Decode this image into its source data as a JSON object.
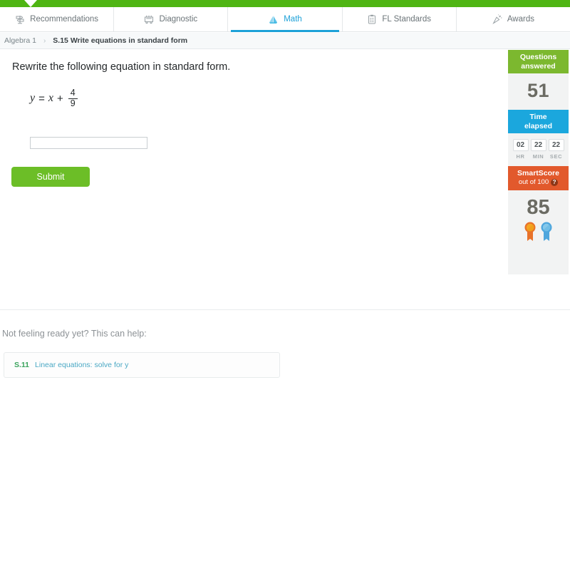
{
  "topbar": {
    "color": "#4fb513"
  },
  "tabs": [
    {
      "label": "Recommendations",
      "icon": "signpost-icon",
      "active": false
    },
    {
      "label": "Diagnostic",
      "icon": "diagnostic-machine-icon",
      "active": false
    },
    {
      "label": "Math",
      "icon": "math-pyramid-icon",
      "active": true
    },
    {
      "label": "FL Standards",
      "icon": "clipboard-icon",
      "active": false
    },
    {
      "label": "Awards",
      "icon": "party-popper-icon",
      "active": false
    }
  ],
  "breadcrumb": {
    "parent": "Algebra 1",
    "separator": "›",
    "current": "S.15 Write equations in standard form"
  },
  "question": {
    "prompt": "Rewrite the following equation in standard form.",
    "equation": {
      "lhs": "y",
      "equals": "=",
      "term": "x",
      "plus": "+",
      "fraction_numerator": "4",
      "fraction_denominator": "9"
    },
    "answer_value": "",
    "answer_placeholder": "",
    "submit_label": "Submit"
  },
  "score_panel": {
    "questions_answered_label": "Questions\nanswered",
    "questions_answered_line1": "Questions",
    "questions_answered_line2": "answered",
    "questions_answered_value": "51",
    "time_label_line1": "Time",
    "time_label_line2": "elapsed",
    "time": {
      "hours": "02",
      "minutes": "22",
      "seconds": "22"
    },
    "time_units": {
      "hr": "HR",
      "min": "MIN",
      "sec": "SEC"
    },
    "smartscore_title": "SmartScore",
    "smartscore_subtitle": "out of 100",
    "smartscore_help": "?",
    "smartscore_value": "85",
    "ribbon_colors": [
      "#e8722a",
      "#4ea6dd"
    ],
    "colors": {
      "green": "#7cb82f",
      "blue": "#1ba7dd",
      "orange": "#e2592c"
    }
  },
  "help_section": {
    "title": "Not feeling ready yet? This can help:",
    "skill_code": "S.11",
    "skill_name": "Linear equations: solve for y"
  }
}
